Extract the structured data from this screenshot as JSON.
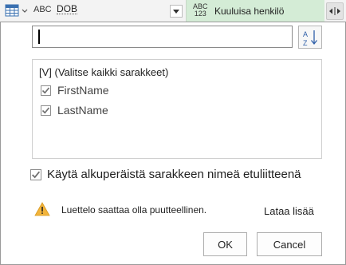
{
  "header": {
    "type_abc": "ABC",
    "column_dob": "DOB",
    "type_abc123_top": "ABC",
    "type_abc123_bottom": "123",
    "active_column": "Kuuluisa henkilö"
  },
  "icons": {
    "table": "table-icon",
    "dropdown": "chevron-down-icon",
    "expand": "expand-arrows-icon",
    "sort": "sort-ascending-icon",
    "warning": "warning-icon",
    "checkbox": "checkmark-icon"
  },
  "search": {
    "value": "",
    "placeholder": ""
  },
  "column_list": {
    "select_all": "[V] (Valitse kaikki sarakkeet)",
    "items": [
      {
        "label": "FirstName",
        "checked": true
      },
      {
        "label": "LastName",
        "checked": true
      }
    ]
  },
  "prefix_option": {
    "label": "Käytä alkuperäistä sarakkeen nimeä etuliitteenä",
    "checked": true
  },
  "warning": {
    "text": "Luettelo saattaa olla puutteellinen."
  },
  "load_more": "Lataa lisää",
  "buttons": {
    "ok": "OK",
    "cancel": "Cancel"
  },
  "colors": {
    "active_header": "#d4ecd6",
    "warning_yellow": "#f2b43c",
    "check_gray": "#6d6d6d"
  }
}
